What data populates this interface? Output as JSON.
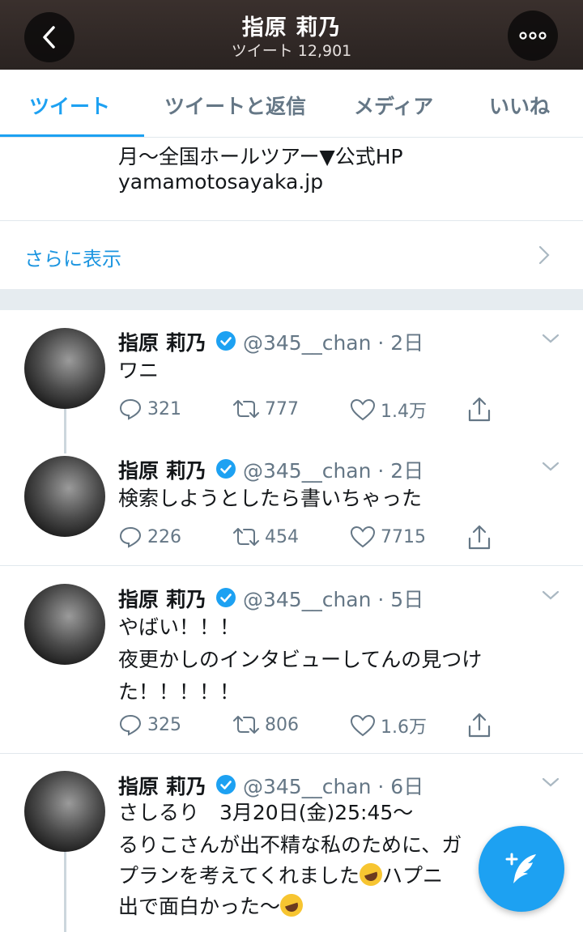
{
  "header": {
    "title": "指原 莉乃",
    "subtitle": "ツイート 12,901"
  },
  "tabs": [
    {
      "label": "ツイート",
      "active": true
    },
    {
      "label": "ツイートと返信",
      "active": false
    },
    {
      "label": "メディア",
      "active": false
    },
    {
      "label": "いいね",
      "active": false
    }
  ],
  "bio": {
    "line1": "月〜全国ホールツアー▼公式HP",
    "line2": "yamamotosayaka.jp",
    "show_more": "さらに表示"
  },
  "tweets": [
    {
      "name": "指原 莉乃",
      "handle_time": "@345__chan · 2日",
      "lines": [
        "ワニ"
      ],
      "replies": "321",
      "retweets": "777",
      "likes": "1.4万"
    },
    {
      "name": "指原 莉乃",
      "handle_time": "@345__chan · 2日",
      "lines": [
        "検索しようとしたら書いちゃった"
      ],
      "replies": "226",
      "retweets": "454",
      "likes": "7715"
    },
    {
      "name": "指原 莉乃",
      "handle_time": "@345__chan · 5日",
      "lines": [
        "やばい！！！",
        "夜更かしのインタビューしてんの見つけ",
        "た！！！！！"
      ],
      "replies": "325",
      "retweets": "806",
      "likes": "1.6万"
    },
    {
      "name": "指原 莉乃",
      "handle_time": "@345__chan · 6日",
      "lines": [
        "さしるり　3月20日(金)25:45〜",
        "るりこさんが出不精な私のために、ガ",
        "プランを考えてくれました",
        "出で面白かった〜"
      ],
      "line3_suffix": "ハプニ",
      "emoji": "rolling-on-floor-laughing-emoji"
    }
  ],
  "colors": {
    "accent": "#1da1f2",
    "verified": "#1da1f2",
    "secondary_text": "#657786"
  }
}
